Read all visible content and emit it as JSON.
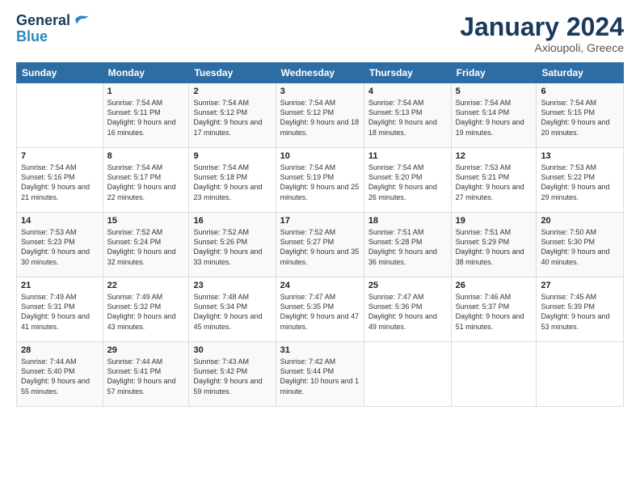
{
  "header": {
    "logo_line1": "General",
    "logo_line2": "Blue",
    "month": "January 2024",
    "location": "Axioupoli, Greece"
  },
  "days_header": [
    "Sunday",
    "Monday",
    "Tuesday",
    "Wednesday",
    "Thursday",
    "Friday",
    "Saturday"
  ],
  "weeks": [
    [
      {
        "day": "",
        "sunrise": "",
        "sunset": "",
        "daylight": ""
      },
      {
        "day": "1",
        "sunrise": "Sunrise: 7:54 AM",
        "sunset": "Sunset: 5:11 PM",
        "daylight": "Daylight: 9 hours and 16 minutes."
      },
      {
        "day": "2",
        "sunrise": "Sunrise: 7:54 AM",
        "sunset": "Sunset: 5:12 PM",
        "daylight": "Daylight: 9 hours and 17 minutes."
      },
      {
        "day": "3",
        "sunrise": "Sunrise: 7:54 AM",
        "sunset": "Sunset: 5:12 PM",
        "daylight": "Daylight: 9 hours and 18 minutes."
      },
      {
        "day": "4",
        "sunrise": "Sunrise: 7:54 AM",
        "sunset": "Sunset: 5:13 PM",
        "daylight": "Daylight: 9 hours and 18 minutes."
      },
      {
        "day": "5",
        "sunrise": "Sunrise: 7:54 AM",
        "sunset": "Sunset: 5:14 PM",
        "daylight": "Daylight: 9 hours and 19 minutes."
      },
      {
        "day": "6",
        "sunrise": "Sunrise: 7:54 AM",
        "sunset": "Sunset: 5:15 PM",
        "daylight": "Daylight: 9 hours and 20 minutes."
      }
    ],
    [
      {
        "day": "7",
        "sunrise": "Sunrise: 7:54 AM",
        "sunset": "Sunset: 5:16 PM",
        "daylight": "Daylight: 9 hours and 21 minutes."
      },
      {
        "day": "8",
        "sunrise": "Sunrise: 7:54 AM",
        "sunset": "Sunset: 5:17 PM",
        "daylight": "Daylight: 9 hours and 22 minutes."
      },
      {
        "day": "9",
        "sunrise": "Sunrise: 7:54 AM",
        "sunset": "Sunset: 5:18 PM",
        "daylight": "Daylight: 9 hours and 23 minutes."
      },
      {
        "day": "10",
        "sunrise": "Sunrise: 7:54 AM",
        "sunset": "Sunset: 5:19 PM",
        "daylight": "Daylight: 9 hours and 25 minutes."
      },
      {
        "day": "11",
        "sunrise": "Sunrise: 7:54 AM",
        "sunset": "Sunset: 5:20 PM",
        "daylight": "Daylight: 9 hours and 26 minutes."
      },
      {
        "day": "12",
        "sunrise": "Sunrise: 7:53 AM",
        "sunset": "Sunset: 5:21 PM",
        "daylight": "Daylight: 9 hours and 27 minutes."
      },
      {
        "day": "13",
        "sunrise": "Sunrise: 7:53 AM",
        "sunset": "Sunset: 5:22 PM",
        "daylight": "Daylight: 9 hours and 29 minutes."
      }
    ],
    [
      {
        "day": "14",
        "sunrise": "Sunrise: 7:53 AM",
        "sunset": "Sunset: 5:23 PM",
        "daylight": "Daylight: 9 hours and 30 minutes."
      },
      {
        "day": "15",
        "sunrise": "Sunrise: 7:52 AM",
        "sunset": "Sunset: 5:24 PM",
        "daylight": "Daylight: 9 hours and 32 minutes."
      },
      {
        "day": "16",
        "sunrise": "Sunrise: 7:52 AM",
        "sunset": "Sunset: 5:26 PM",
        "daylight": "Daylight: 9 hours and 33 minutes."
      },
      {
        "day": "17",
        "sunrise": "Sunrise: 7:52 AM",
        "sunset": "Sunset: 5:27 PM",
        "daylight": "Daylight: 9 hours and 35 minutes."
      },
      {
        "day": "18",
        "sunrise": "Sunrise: 7:51 AM",
        "sunset": "Sunset: 5:28 PM",
        "daylight": "Daylight: 9 hours and 36 minutes."
      },
      {
        "day": "19",
        "sunrise": "Sunrise: 7:51 AM",
        "sunset": "Sunset: 5:29 PM",
        "daylight": "Daylight: 9 hours and 38 minutes."
      },
      {
        "day": "20",
        "sunrise": "Sunrise: 7:50 AM",
        "sunset": "Sunset: 5:30 PM",
        "daylight": "Daylight: 9 hours and 40 minutes."
      }
    ],
    [
      {
        "day": "21",
        "sunrise": "Sunrise: 7:49 AM",
        "sunset": "Sunset: 5:31 PM",
        "daylight": "Daylight: 9 hours and 41 minutes."
      },
      {
        "day": "22",
        "sunrise": "Sunrise: 7:49 AM",
        "sunset": "Sunset: 5:32 PM",
        "daylight": "Daylight: 9 hours and 43 minutes."
      },
      {
        "day": "23",
        "sunrise": "Sunrise: 7:48 AM",
        "sunset": "Sunset: 5:34 PM",
        "daylight": "Daylight: 9 hours and 45 minutes."
      },
      {
        "day": "24",
        "sunrise": "Sunrise: 7:47 AM",
        "sunset": "Sunset: 5:35 PM",
        "daylight": "Daylight: 9 hours and 47 minutes."
      },
      {
        "day": "25",
        "sunrise": "Sunrise: 7:47 AM",
        "sunset": "Sunset: 5:36 PM",
        "daylight": "Daylight: 9 hours and 49 minutes."
      },
      {
        "day": "26",
        "sunrise": "Sunrise: 7:46 AM",
        "sunset": "Sunset: 5:37 PM",
        "daylight": "Daylight: 9 hours and 51 minutes."
      },
      {
        "day": "27",
        "sunrise": "Sunrise: 7:45 AM",
        "sunset": "Sunset: 5:39 PM",
        "daylight": "Daylight: 9 hours and 53 minutes."
      }
    ],
    [
      {
        "day": "28",
        "sunrise": "Sunrise: 7:44 AM",
        "sunset": "Sunset: 5:40 PM",
        "daylight": "Daylight: 9 hours and 55 minutes."
      },
      {
        "day": "29",
        "sunrise": "Sunrise: 7:44 AM",
        "sunset": "Sunset: 5:41 PM",
        "daylight": "Daylight: 9 hours and 57 minutes."
      },
      {
        "day": "30",
        "sunrise": "Sunrise: 7:43 AM",
        "sunset": "Sunset: 5:42 PM",
        "daylight": "Daylight: 9 hours and 59 minutes."
      },
      {
        "day": "31",
        "sunrise": "Sunrise: 7:42 AM",
        "sunset": "Sunset: 5:44 PM",
        "daylight": "Daylight: 10 hours and 1 minute."
      },
      {
        "day": "",
        "sunrise": "",
        "sunset": "",
        "daylight": ""
      },
      {
        "day": "",
        "sunrise": "",
        "sunset": "",
        "daylight": ""
      },
      {
        "day": "",
        "sunrise": "",
        "sunset": "",
        "daylight": ""
      }
    ]
  ]
}
